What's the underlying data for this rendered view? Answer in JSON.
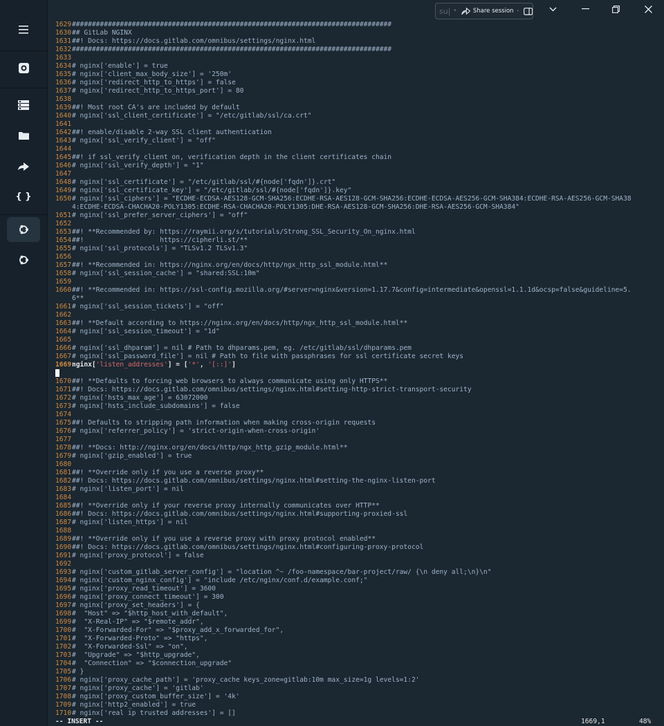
{
  "sidebar": {
    "items": [
      {
        "name": "menu-icon",
        "glyph": "☰"
      },
      {
        "name": "settings-icon",
        "glyph": "⚙"
      },
      {
        "name": "server-list-icon",
        "glyph": "▤"
      },
      {
        "name": "folder-icon",
        "glyph": "▬"
      },
      {
        "name": "forward-icon",
        "glyph": "➦"
      },
      {
        "name": "snippets-icon",
        "glyph": "{}"
      },
      {
        "name": "ubuntu-icon",
        "glyph": "◌"
      },
      {
        "name": "ubuntu-icon-2",
        "glyph": "◌"
      }
    ]
  },
  "titlebar": {
    "share_input": "su|",
    "share_label": "Share session"
  },
  "editor": {
    "cursor_line": "1669",
    "lines": [
      {
        "n": "1629",
        "t": "################################################################################"
      },
      {
        "n": "1630",
        "t": "## GitLab NGINX"
      },
      {
        "n": "1631",
        "t": "##! Docs: https://docs.gitlab.com/omnibus/settings/nginx.html"
      },
      {
        "n": "1632",
        "t": "################################################################################"
      },
      {
        "n": "1633",
        "t": ""
      },
      {
        "n": "1634",
        "t": "# nginx['enable'] = true"
      },
      {
        "n": "1635",
        "t": "# nginx['client_max_body_size'] = '250m'"
      },
      {
        "n": "1636",
        "t": "# nginx['redirect_http_to_https'] = false"
      },
      {
        "n": "1637",
        "t": "# nginx['redirect_http_to_https_port'] = 80"
      },
      {
        "n": "1638",
        "t": ""
      },
      {
        "n": "1639",
        "t": "##! Most root CA's are included by default"
      },
      {
        "n": "1640",
        "t": "# nginx['ssl_client_certificate'] = \"/etc/gitlab/ssl/ca.crt\""
      },
      {
        "n": "1641",
        "t": ""
      },
      {
        "n": "1642",
        "t": "##! enable/disable 2-way SSL client authentication"
      },
      {
        "n": "1643",
        "t": "# nginx['ssl_verify_client'] = \"off\""
      },
      {
        "n": "1644",
        "t": ""
      },
      {
        "n": "1645",
        "t": "##! if ssl_verify_client on, verification depth in the client certificates chain"
      },
      {
        "n": "1646",
        "t": "# nginx['ssl_verify_depth'] = \"1\""
      },
      {
        "n": "1647",
        "t": ""
      },
      {
        "n": "1648",
        "t": "# nginx['ssl_certificate'] = \"/etc/gitlab/ssl/#{node['fqdn']}.crt\""
      },
      {
        "n": "1649",
        "t": "# nginx['ssl_certificate_key'] = \"/etc/gitlab/ssl/#{node['fqdn']}.key\""
      },
      {
        "n": "1650",
        "t": "# nginx['ssl_ciphers'] = \"ECDHE-ECDSA-AES128-GCM-SHA256:ECDHE-RSA-AES128-GCM-SHA256:ECDHE-ECDSA-AES256-GCM-SHA384:ECDHE-RSA-AES256-GCM-SHA38"
      },
      {
        "n": "",
        "t": "4:ECDHE-ECDSA-CHACHA20-POLY1305:ECDHE-RSA-CHACHA20-POLY1305:DHE-RSA-AES128-GCM-SHA256:DHE-RSA-AES256-GCM-SHA384\""
      },
      {
        "n": "1651",
        "t": "# nginx['ssl_prefer_server_ciphers'] = \"off\""
      },
      {
        "n": "1652",
        "t": ""
      },
      {
        "n": "1653",
        "t": "##! **Recommended by: https://raymii.org/s/tutorials/Strong_SSL_Security_On_nginx.html"
      },
      {
        "n": "1654",
        "t": "##!                   https://cipherli.st/**"
      },
      {
        "n": "1655",
        "t": "# nginx['ssl_protocols'] = \"TLSv1.2 TLSv1.3\""
      },
      {
        "n": "1656",
        "t": ""
      },
      {
        "n": "1657",
        "t": "##! **Recommended in: https://nginx.org/en/docs/http/ngx_http_ssl_module.html**"
      },
      {
        "n": "1658",
        "t": "# nginx['ssl_session_cache'] = \"shared:SSL:10m\""
      },
      {
        "n": "1659",
        "t": ""
      },
      {
        "n": "1660",
        "t": "##! **Recommended in: https://ssl-config.mozilla.org/#server=nginx&version=1.17.7&config=intermediate&openssl=1.1.1d&ocsp=false&guideline=5."
      },
      {
        "n": "",
        "t": "6**"
      },
      {
        "n": "1661",
        "t": "# nginx['ssl_session_tickets'] = \"off\""
      },
      {
        "n": "1662",
        "t": ""
      },
      {
        "n": "1663",
        "t": "##! **Default according to https://nginx.org/en/docs/http/ngx_http_ssl_module.html**"
      },
      {
        "n": "1664",
        "t": "# nginx['ssl_session_timeout'] = \"1d\""
      },
      {
        "n": "1665",
        "t": ""
      },
      {
        "n": "1666",
        "t": "# nginx['ssl_dhparam'] = nil # Path to dhparams.pem, eg. /etc/gitlab/ssl/dhparams.pem"
      },
      {
        "n": "1667",
        "t": "# nginx['ssl_password_file'] = nil # Path to file with passphrases for ssl certificate secret keys"
      },
      {
        "n": "1669",
        "t": "nginx['listen_addresses'] = ['*', '[::]']",
        "cur": true
      },
      {
        "n": "",
        "t": "",
        "cursor": true
      },
      {
        "n": "1670",
        "t": "##! **Defaults to forcing web browsers to always communicate using only HTTPS**"
      },
      {
        "n": "1671",
        "t": "##! Docs: https://docs.gitlab.com/omnibus/settings/nginx.html#setting-http-strict-transport-security"
      },
      {
        "n": "1672",
        "t": "# nginx['hsts_max_age'] = 63072000"
      },
      {
        "n": "1673",
        "t": "# nginx['hsts_include_subdomains'] = false"
      },
      {
        "n": "1674",
        "t": ""
      },
      {
        "n": "1675",
        "t": "##! Defaults to stripping path information when making cross-origin requests"
      },
      {
        "n": "1676",
        "t": "# nginx['referrer_policy'] = 'strict-origin-when-cross-origin'"
      },
      {
        "n": "1677",
        "t": ""
      },
      {
        "n": "1678",
        "t": "##! **Docs: http://nginx.org/en/docs/http/ngx_http_gzip_module.html**"
      },
      {
        "n": "1679",
        "t": "# nginx['gzip_enabled'] = true"
      },
      {
        "n": "1680",
        "t": ""
      },
      {
        "n": "1681",
        "t": "##! **Override only if you use a reverse proxy**"
      },
      {
        "n": "1682",
        "t": "##! Docs: https://docs.gitlab.com/omnibus/settings/nginx.html#setting-the-nginx-listen-port"
      },
      {
        "n": "1683",
        "t": "# nginx['listen_port'] = nil"
      },
      {
        "n": "1684",
        "t": ""
      },
      {
        "n": "1685",
        "t": "##! **Override only if your reverse proxy internally communicates over HTTP**"
      },
      {
        "n": "1686",
        "t": "##! Docs: https://docs.gitlab.com/omnibus/settings/nginx.html#supporting-proxied-ssl"
      },
      {
        "n": "1687",
        "t": "# nginx['listen_https'] = nil"
      },
      {
        "n": "1688",
        "t": ""
      },
      {
        "n": "1689",
        "t": "##! **Override only if you use a reverse proxy with proxy protocol enabled**"
      },
      {
        "n": "1690",
        "t": "##! Docs: https://docs.gitlab.com/omnibus/settings/nginx.html#configuring-proxy-protocol"
      },
      {
        "n": "1691",
        "t": "# nginx['proxy_protocol'] = false"
      },
      {
        "n": "1692",
        "t": ""
      },
      {
        "n": "1693",
        "t": "# nginx['custom_gitlab_server_config'] = \"location ^~ /foo-namespace/bar-project/raw/ {\\n deny all;\\n}\\n\""
      },
      {
        "n": "1694",
        "t": "# nginx['custom_nginx_config'] = \"include /etc/nginx/conf.d/example.conf;\""
      },
      {
        "n": "1695",
        "t": "# nginx['proxy_read_timeout'] = 3600"
      },
      {
        "n": "1696",
        "t": "# nginx['proxy_connect_timeout'] = 300"
      },
      {
        "n": "1697",
        "t": "# nginx['proxy_set_headers'] = {"
      },
      {
        "n": "1698",
        "t": "#  \"Host\" => \"$http_host_with_default\","
      },
      {
        "n": "1699",
        "t": "#  \"X-Real-IP\" => \"$remote_addr\","
      },
      {
        "n": "1700",
        "t": "#  \"X-Forwarded-For\" => \"$proxy_add_x_forwarded_for\","
      },
      {
        "n": "1701",
        "t": "#  \"X-Forwarded-Proto\" => \"https\","
      },
      {
        "n": "1702",
        "t": "#  \"X-Forwarded-Ssl\" => \"on\","
      },
      {
        "n": "1703",
        "t": "#  \"Upgrade\" => \"$http_upgrade\","
      },
      {
        "n": "1704",
        "t": "#  \"Connection\" => \"$connection_upgrade\""
      },
      {
        "n": "1705",
        "t": "# }"
      },
      {
        "n": "1706",
        "t": "# nginx['proxy_cache_path'] = 'proxy_cache keys_zone=gitlab:10m max_size=1g levels=1:2'"
      },
      {
        "n": "1707",
        "t": "# nginx['proxy_cache'] = 'gitlab'"
      },
      {
        "n": "1708",
        "t": "# nginx['proxy_custom_buffer_size'] = '4k'"
      },
      {
        "n": "1709",
        "t": "# nginx['http2_enabled'] = true"
      },
      {
        "n": "1710",
        "t": "# nginx['real_ip_trusted_addresses'] = []"
      }
    ]
  },
  "status": {
    "mode": "-- INSERT --",
    "position": "1669,1",
    "percent": "48%"
  },
  "colors": {
    "background": "#1b2731",
    "line_number": "#d18b3f",
    "comment_text": "#9fb3c8",
    "string_red": "#d46a6a"
  }
}
